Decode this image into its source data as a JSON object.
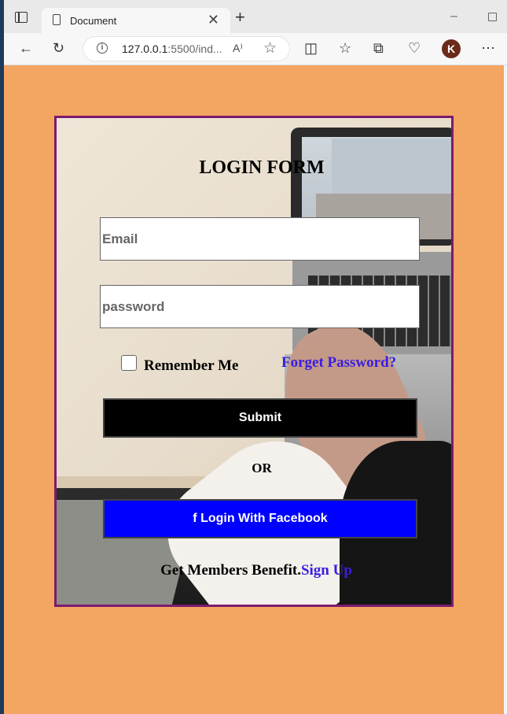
{
  "browser": {
    "tab_title": "Document",
    "tab_close": "✕",
    "new_tab": "+",
    "minimize": "–",
    "url_host": "127.0.0.1",
    "url_rest": ":5500/ind...",
    "read_aloud": "A⁾",
    "favorite": "☆",
    "back": "←",
    "refresh": "↻",
    "split": "◫",
    "favorites": "☆",
    "collections": "⧉",
    "health": "♡",
    "avatar_letter": "K",
    "menu": "⋯"
  },
  "form": {
    "title": "LOGIN FORM",
    "email_placeholder": "Email",
    "password_placeholder": "password",
    "remember_label": "Remember Me",
    "forget_label": "Forget Password?",
    "submit_label": "Submit",
    "or_label": "OR",
    "facebook_label": "f Login With Facebook",
    "footer_text": "Get Members Benefit.",
    "signup_label": "Sign Up"
  },
  "colors": {
    "page_background": "#f3a562",
    "card_border": "#7d1a6e",
    "link": "#3a1de0",
    "submit_bg": "#000000",
    "facebook_bg": "#0000ff"
  }
}
